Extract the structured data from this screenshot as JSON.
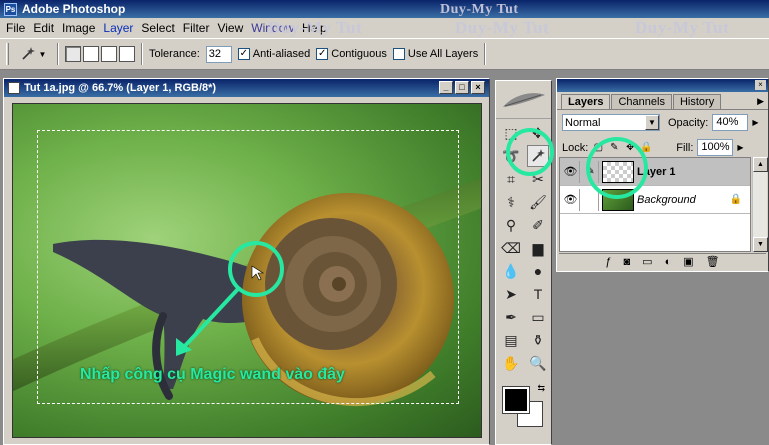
{
  "app": {
    "title": "Adobe Photoshop",
    "watermark": [
      "Duy-My Tut",
      "Duy-My Tut",
      "Duy-My Tut",
      "Duy-My Tut"
    ]
  },
  "menu": [
    "File",
    "Edit",
    "Image",
    "Layer",
    "Select",
    "Filter",
    "View",
    "Window",
    "Help"
  ],
  "options": {
    "tolerance_label": "Tolerance:",
    "tolerance_value": "32",
    "anti_aliased_label": "Anti-aliased",
    "anti_aliased": true,
    "contiguous_label": "Contiguous",
    "contiguous": true,
    "use_all_layers_label": "Use All Layers",
    "use_all_layers": false
  },
  "document": {
    "title": "Tut 1a.jpg @ 66.7% (Layer 1, RGB/8*)",
    "annotation": "Nhấp công cụ Magic wand vào đây",
    "annotation_color": "#27e8a0"
  },
  "layers_palette": {
    "tabs": [
      "Layers",
      "Channels",
      "History"
    ],
    "active_tab": "Layers",
    "blend_mode": "Normal",
    "opacity_label": "Opacity:",
    "opacity": "40%",
    "lock_label": "Lock:",
    "fill_label": "Fill:",
    "fill": "100%",
    "layers": [
      {
        "name": "Layer 1",
        "selected": true,
        "thumb": "transparent"
      },
      {
        "name": "Background",
        "selected": false,
        "thumb": "photo",
        "locked": true
      }
    ]
  },
  "colors": {
    "foreground": "#000000",
    "background": "#ffffff",
    "highlight": "#27e8a0"
  }
}
